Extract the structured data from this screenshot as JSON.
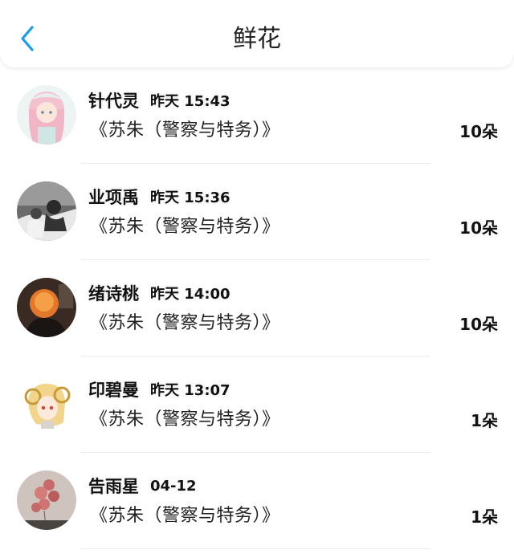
{
  "header": {
    "title": "鲜花",
    "back_icon": "chevron-left-icon",
    "accent_color": "#1a9bf0"
  },
  "items": [
    {
      "name": "针代灵",
      "time": "昨天 15:43",
      "book": "《苏朱（警察与特务）》",
      "count": "10朵",
      "avatar": "anime-girl-pink-hair"
    },
    {
      "name": "业项禹",
      "time": "昨天 15:36",
      "book": "《苏朱（警察与特务）》",
      "count": "10朵",
      "avatar": "bw-photo-couple"
    },
    {
      "name": "绪诗桃",
      "time": "昨天 14:00",
      "book": "《苏朱（警察与特务）》",
      "count": "10朵",
      "avatar": "orange-hair-dark-photo"
    },
    {
      "name": "印碧曼",
      "time": "昨天 13:07",
      "book": "《苏朱（警察与特务）》",
      "count": "1朵",
      "avatar": "anime-blonde-horns"
    },
    {
      "name": "告雨星",
      "time": "04-12",
      "book": "《苏朱（警察与特务）》",
      "count": "1朵",
      "avatar": "pink-balloons-photo"
    }
  ]
}
